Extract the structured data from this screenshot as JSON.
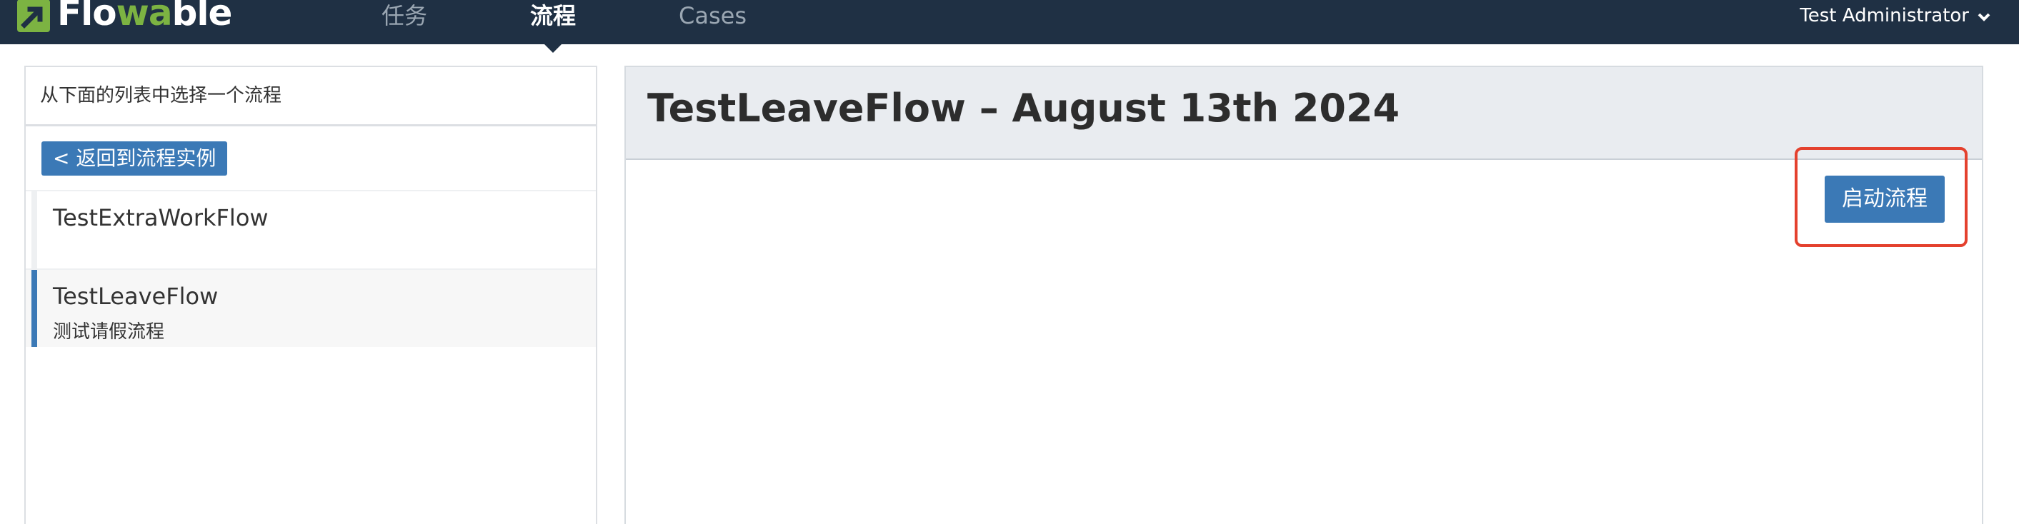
{
  "navbar": {
    "logo_text_pre": "Flo",
    "logo_text_accent": "wa",
    "logo_text_post": "ble",
    "tabs": [
      {
        "label": "任务",
        "active": false
      },
      {
        "label": "流程",
        "active": true
      },
      {
        "label": "Cases",
        "active": false
      }
    ],
    "user": "Test Administrator",
    "user_icon": "chevron-down-icon"
  },
  "left": {
    "header": "从下面的列表中选择一个流程",
    "back_button": "< 返回到流程实例",
    "processes": [
      {
        "name": "TestExtraWorkFlow",
        "description": "",
        "selected": false
      },
      {
        "name": "TestLeaveFlow",
        "description": "测试请假流程",
        "selected": true
      }
    ]
  },
  "right": {
    "title": "TestLeaveFlow – August 13th 2024",
    "start_button": "启动流程"
  },
  "colors": {
    "navbar": "#1f3044",
    "brand_green": "#7cb342",
    "primary": "#3b79b6",
    "highlight": "#e4412e"
  }
}
